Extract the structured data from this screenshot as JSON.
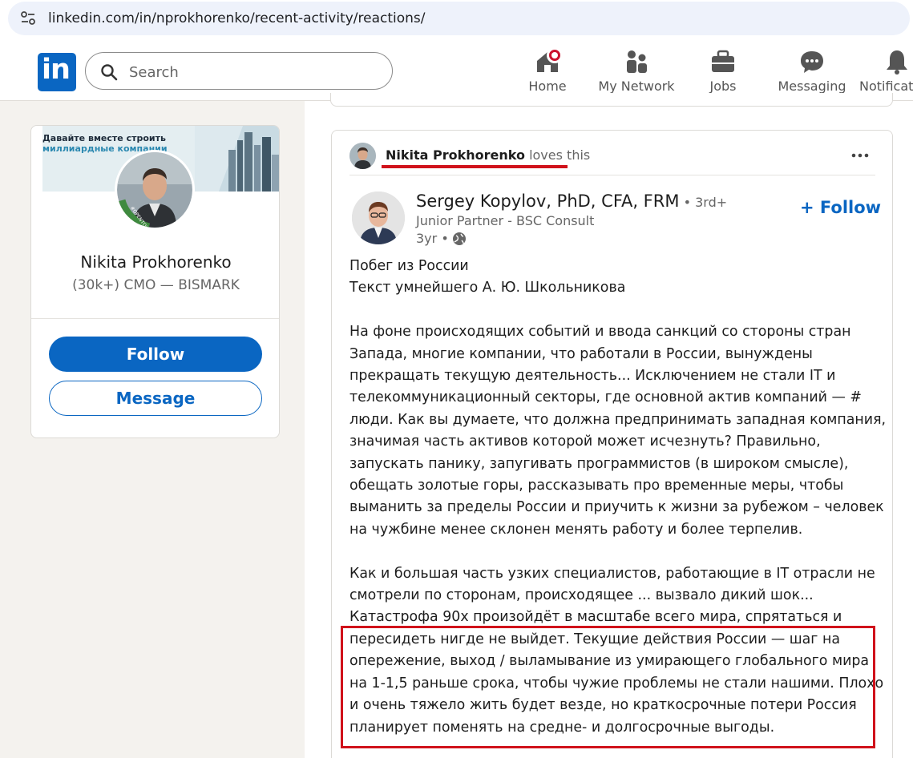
{
  "browser": {
    "url": "linkedin.com/in/nprokhorenko/recent-activity/reactions/"
  },
  "header": {
    "search_placeholder": "Search",
    "nav": [
      {
        "label": "Home",
        "icon": "home-icon"
      },
      {
        "label": "My Network",
        "icon": "people-icon"
      },
      {
        "label": "Jobs",
        "icon": "briefcase-icon"
      },
      {
        "label": "Messaging",
        "icon": "chat-icon"
      },
      {
        "label": "Notificat",
        "icon": "bell-icon"
      }
    ],
    "logo_text": "in"
  },
  "profile": {
    "banner_line1": "Давайте вместе строить",
    "banner_line2": "миллиардные компании",
    "name": "Nikita Prokhorenko",
    "headline": "(30k+) CMO — BISMARK",
    "follow_label": "Follow",
    "message_label": "Message"
  },
  "post": {
    "actor_name": "Nikita Prokhorenko",
    "actor_verb": " loves this",
    "author_name": "Sergey Kopylov, PhD, CFA, FRM",
    "author_degree": " • 3rd+",
    "author_title": "Junior Partner - BSC Consult",
    "author_time": "3yr •",
    "follow_label": "+ Follow",
    "body_lines": [
      "Побег из России",
      "Текст умнейшего А. Ю. Школьникова",
      "",
      "На фоне происходящих событий и ввода санкций со стороны стран",
      "Запада, многие компании, что работали в России, вынуждены",
      "прекращать текущую деятельность... Исключением не стали IT и",
      "телекоммуникационный секторы, где основной актив компаний — #",
      "люди. Как вы думаете, что должна предпринимать западная компания,",
      "значимая часть активов которой может исчезнуть? Правильно,",
      "запускать панику, запугивать программистов (в широком смысле),",
      "обещать золотые горы, рассказывать про временные меры, чтобы",
      "выманить за пределы России и приучить к жизни за рубежом – человек",
      "на чужбине менее склонен менять работу и более терпелив.",
      "",
      "Как и большая часть узких специалистов, работающие в IT отрасли не",
      "смотрели по сторонам, происходящее ... вызвало дикий шок...",
      "Катастрофа 90х произойдёт в масштабе всего мира, спрятаться и",
      "пересидеть нигде не выйдет. Текущие действия России — шаг на",
      "опережение, выход / выламывание из умирающего глобального мира",
      "на 1-1,5 раньше срока, чтобы чужие проблемы не стали нашими. Плохо",
      "и очень тяжело жить будет везде, но краткосрочные потери Россия",
      "планирует поменять на средне- и долгосрочные выгоды."
    ]
  },
  "colors": {
    "linkedin_blue": "#0a66c2",
    "annotation_red": "#d0121b",
    "page_bg": "#f4f2ee"
  }
}
